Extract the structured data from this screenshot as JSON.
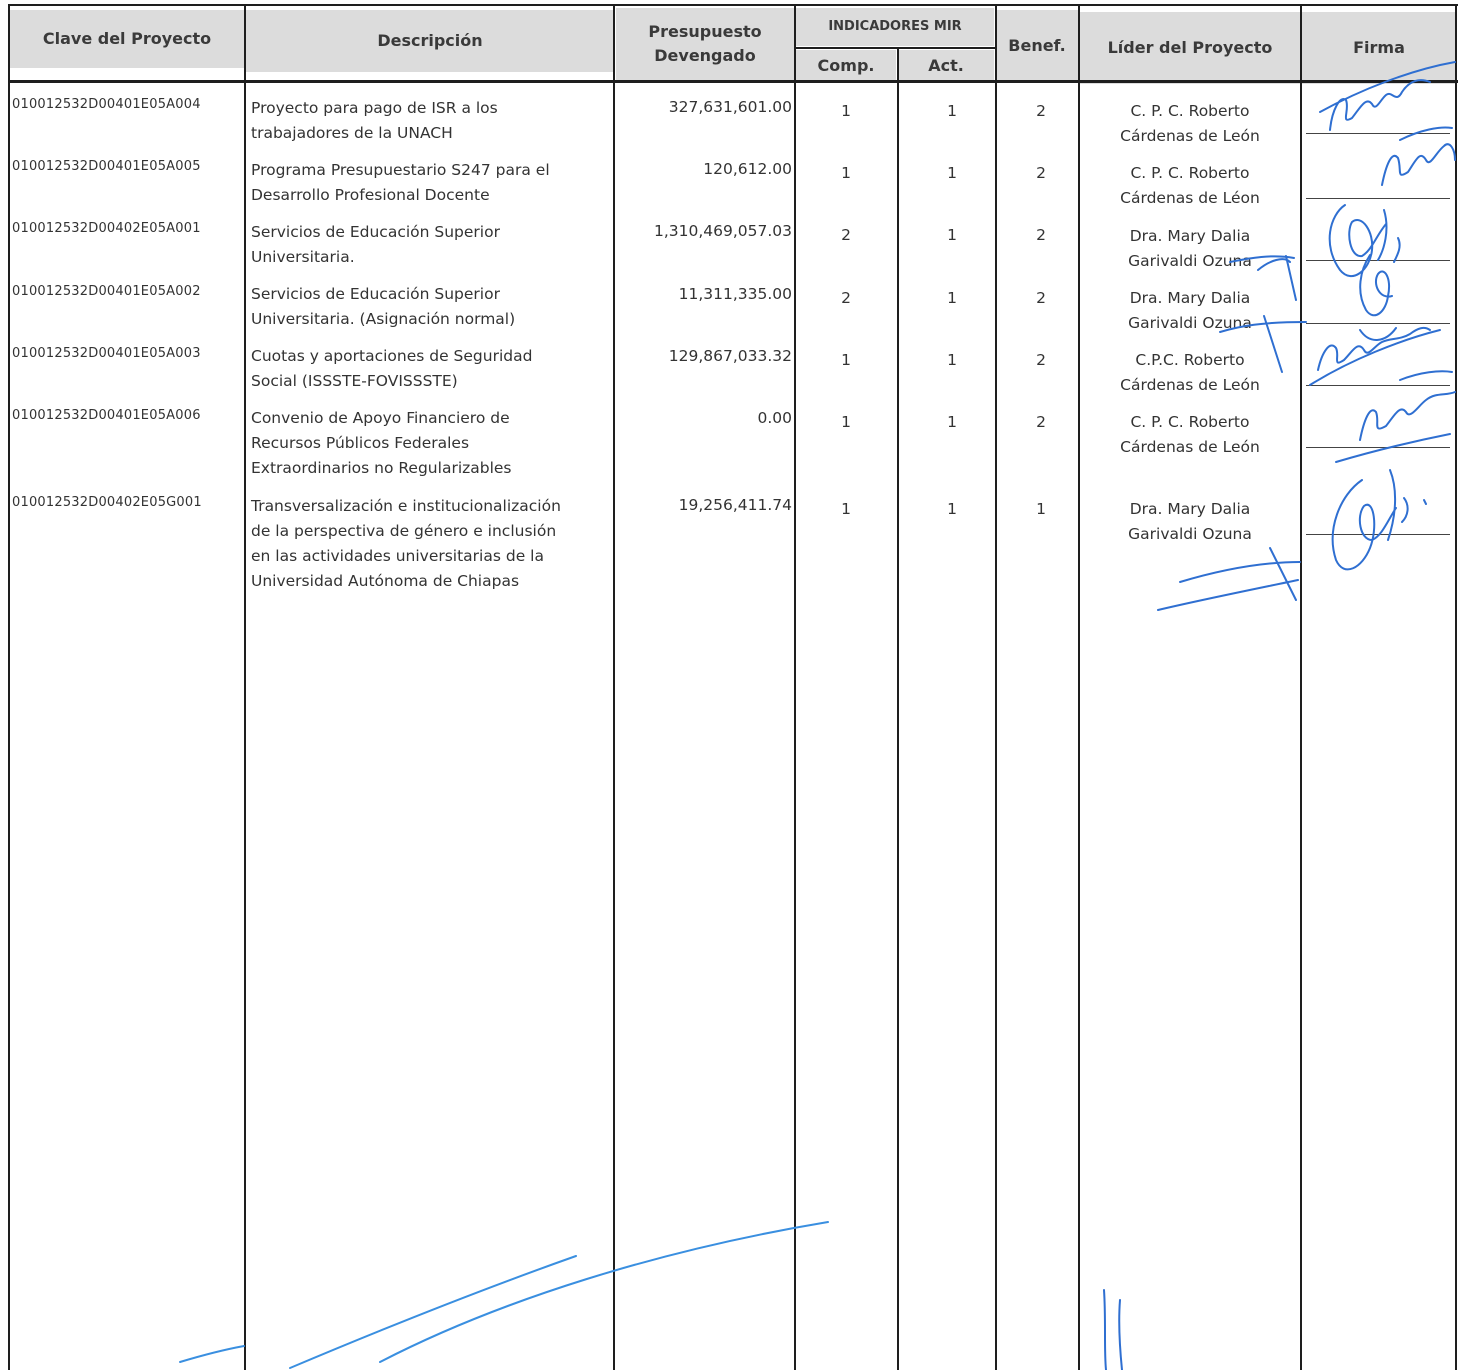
{
  "headers": {
    "clave": "Clave del Proyecto",
    "descripcion": "Descripción",
    "presupuesto_line1": "Presupuesto",
    "presupuesto_line2": "Devengado",
    "indicadores": "INDICADORES MIR",
    "comp": "Comp.",
    "act": "Act.",
    "benef": "Benef.",
    "lider": "Líder del Proyecto",
    "firma": "Firma"
  },
  "rows": [
    {
      "clave": "010012532D00401E05A004",
      "desc1": "Proyecto para pago de ISR a los",
      "desc2": "trabajadores de la UNACH",
      "desc3": "",
      "desc4": "",
      "presupuesto": "327,631,601.00",
      "comp": "1",
      "act": "1",
      "benef": "2",
      "lider1": "C. P. C. Roberto",
      "lider2": "Cárdenas de León"
    },
    {
      "clave": "010012532D00401E05A005",
      "desc1": "Programa Presupuestario S247 para el",
      "desc2": "Desarrollo Profesional Docente",
      "desc3": "",
      "desc4": "",
      "presupuesto": "120,612.00",
      "comp": "1",
      "act": "1",
      "benef": "2",
      "lider1": "C. P. C. Roberto",
      "lider2": "Cárdenas de Léon"
    },
    {
      "clave": "010012532D00402E05A001",
      "desc1": "Servicios de Educación Superior",
      "desc2": "Universitaria.",
      "desc3": "",
      "desc4": "",
      "presupuesto": "1,310,469,057.03",
      "comp": "2",
      "act": "1",
      "benef": "2",
      "lider1": "Dra. Mary Dalia",
      "lider2": "Garivaldi Ozuna"
    },
    {
      "clave": "010012532D00401E05A002",
      "desc1": "Servicios de Educación Superior",
      "desc2": "Universitaria. (Asignación normal)",
      "desc3": "",
      "desc4": "",
      "presupuesto": "11,311,335.00",
      "comp": "2",
      "act": "1",
      "benef": "2",
      "lider1": "Dra. Mary Dalia",
      "lider2": "Garivaldi Ozuna"
    },
    {
      "clave": "010012532D00401E05A003",
      "desc1": "Cuotas y aportaciones de Seguridad",
      "desc2": "Social (ISSSTE-FOVISSSTE)",
      "desc3": "",
      "desc4": "",
      "presupuesto": "129,867,033.32",
      "comp": "1",
      "act": "1",
      "benef": "2",
      "lider1": "C.P.C. Roberto",
      "lider2": "Cárdenas de León"
    },
    {
      "clave": "010012532D00401E05A006",
      "desc1": "Convenio de Apoyo Financiero de",
      "desc2": "Recursos Públicos Federales",
      "desc3": "Extraordinarios no Regularizables",
      "desc4": "",
      "presupuesto": "0.00",
      "comp": "1",
      "act": "1",
      "benef": "2",
      "lider1": "C. P. C. Roberto",
      "lider2": "Cárdenas de León"
    },
    {
      "clave": "010012532D00402E05G001",
      "desc1": "Transversalización e institucionalización",
      "desc2": "de la perspectiva de género e inclusión",
      "desc3": "en las actividades universitarias de la",
      "desc4": "Universidad Autónoma de Chiapas",
      "presupuesto": "19,256,411.74",
      "comp": "1",
      "act": "1",
      "benef": "1",
      "lider1": "Dra. Mary Dalia",
      "lider2": "Garivaldi Ozuna"
    }
  ],
  "colors": {
    "header_bg": "#dcdcdc",
    "rule": "#1e1e1e",
    "signature_ink": "#2f6fd1",
    "stroke_ink": "#3a8fe0"
  }
}
